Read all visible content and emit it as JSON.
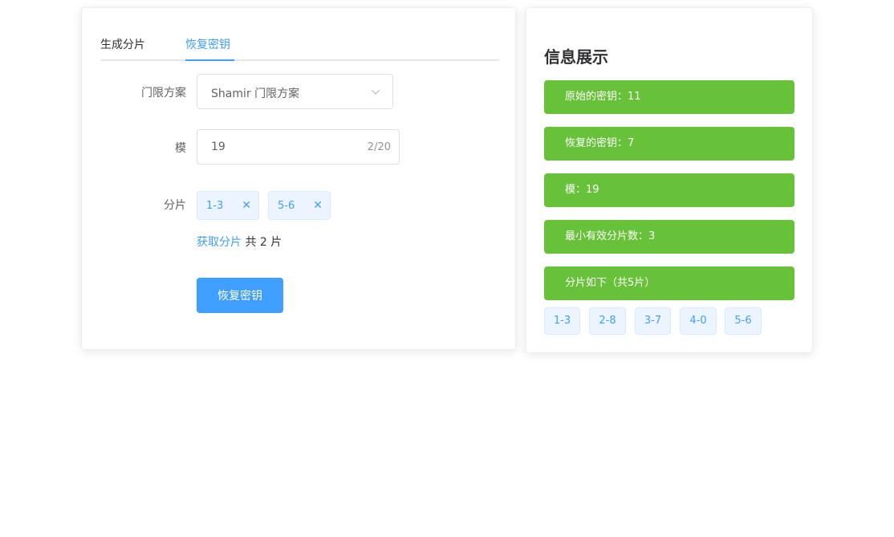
{
  "tabs": [
    "生成分片",
    "恢复密钥"
  ],
  "active_tab": "恢复密钥",
  "form": {
    "scheme_label": "门限方案",
    "scheme_value": "Shamir 门限方案",
    "modulus_label": "模",
    "modulus_value": "19",
    "modulus_count": "2/20",
    "shares_label": "分片",
    "shares_tags": [
      "1-3",
      "5-6"
    ],
    "fetch_link": "获取分片",
    "fetch_total": "共 2 片",
    "recover_button": "恢复密钥"
  },
  "info": {
    "title": "信息展示",
    "bars": [
      "原始的密钥：11",
      "恢复的密钥：7",
      "模：19",
      "最小有效分片数：3",
      "分片如下（共5片）"
    ],
    "shares": [
      "1-3",
      "2-8",
      "3-7",
      "4-0",
      "5-6"
    ]
  },
  "colors": {
    "accent": "#409eff",
    "success": "#67c23a",
    "tag_bg": "#ecf5ff"
  }
}
